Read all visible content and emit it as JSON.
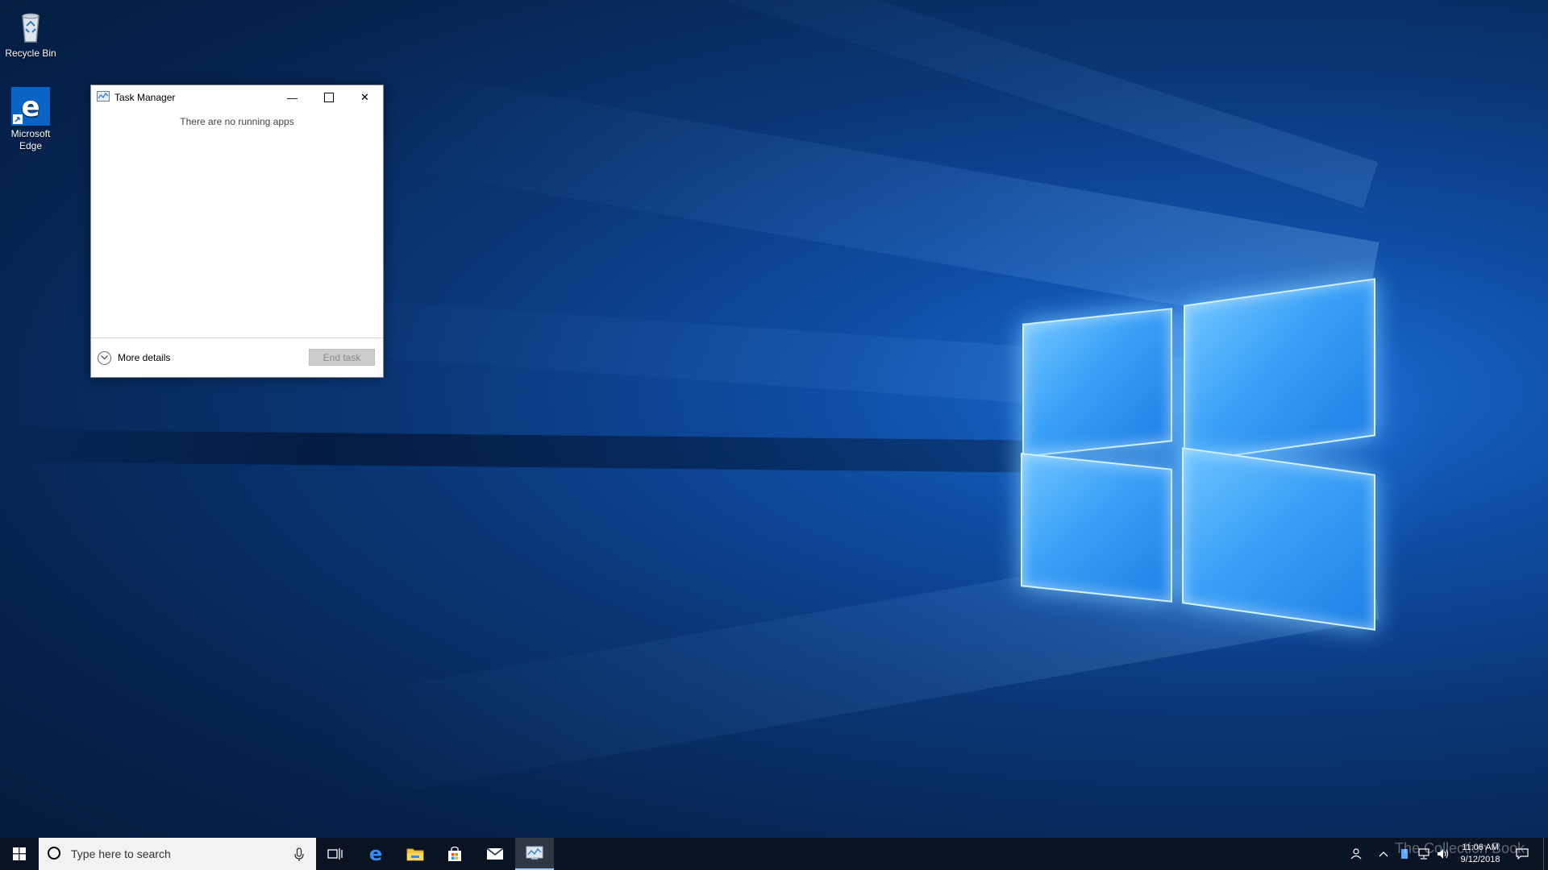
{
  "desktop": {
    "icons": [
      {
        "label": "Recycle Bin",
        "icon": "recycle-bin-icon"
      },
      {
        "label": "Microsoft Edge",
        "icon": "edge-icon"
      }
    ]
  },
  "task_manager": {
    "title": "Task Manager",
    "empty_message": "There are no running apps",
    "more_details_label": "More details",
    "end_task_label": "End task",
    "minimize_glyph": "—",
    "close_glyph": "✕"
  },
  "taskbar": {
    "search_placeholder": "Type here to search",
    "pinned": [
      "task-view-icon",
      "edge-icon",
      "file-explorer-icon",
      "store-icon",
      "mail-icon",
      "task-manager-icon"
    ],
    "clock_time": "11:06 AM",
    "clock_date": "9/12/2018",
    "watermark": "The Collection Book"
  },
  "colors": {
    "accent": "#0078d7",
    "taskbar": "#0a1220",
    "end_task_disabled": "#cccccc"
  }
}
